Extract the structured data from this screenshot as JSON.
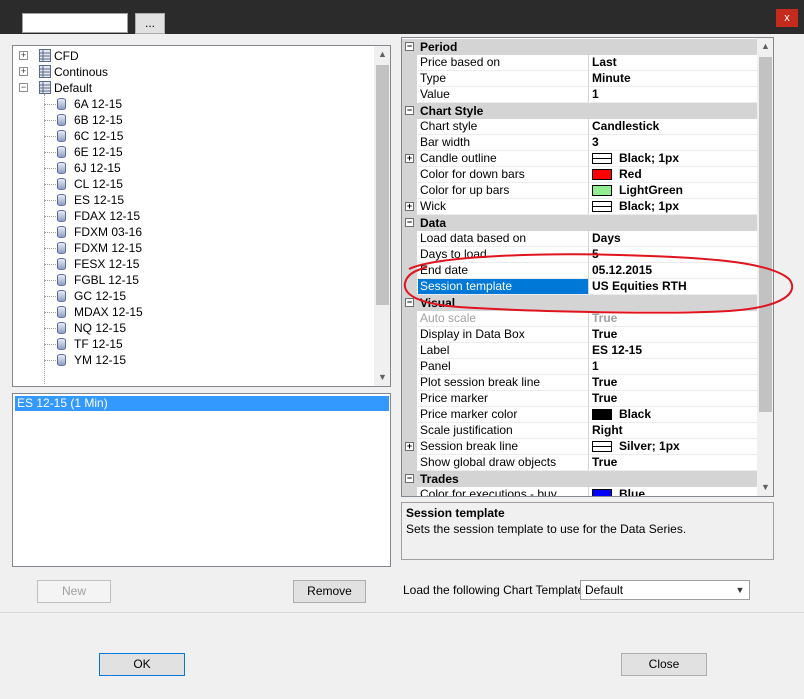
{
  "window": {
    "close_glyph": "x"
  },
  "search": {
    "value": "",
    "placeholder": ""
  },
  "browse_button": {
    "label": "..."
  },
  "tree": {
    "nodes": [
      {
        "label": "CFD",
        "level": 0,
        "expander": "+"
      },
      {
        "label": "Continous",
        "level": 0,
        "expander": "+"
      },
      {
        "label": "Default",
        "level": 0,
        "expander": "−"
      },
      {
        "label": "6A 12-15",
        "level": 1
      },
      {
        "label": "6B 12-15",
        "level": 1
      },
      {
        "label": "6C 12-15",
        "level": 1
      },
      {
        "label": "6E 12-15",
        "level": 1
      },
      {
        "label": "6J 12-15",
        "level": 1
      },
      {
        "label": "CL 12-15",
        "level": 1
      },
      {
        "label": "ES 12-15",
        "level": 1
      },
      {
        "label": "FDAX 12-15",
        "level": 1
      },
      {
        "label": "FDXM 03-16",
        "level": 1
      },
      {
        "label": "FDXM 12-15",
        "level": 1
      },
      {
        "label": "FESX 12-15",
        "level": 1
      },
      {
        "label": "FGBL 12-15",
        "level": 1
      },
      {
        "label": "GC 12-15",
        "level": 1
      },
      {
        "label": "MDAX 12-15",
        "level": 1
      },
      {
        "label": "NQ 12-15",
        "level": 1
      },
      {
        "label": "TF 12-15",
        "level": 1
      },
      {
        "label": "YM 12-15",
        "level": 1
      }
    ],
    "scroll_up_glyph": "▲",
    "scroll_down_glyph": "▼"
  },
  "series_list": {
    "items": [
      "ES 12-15 (1 Min)"
    ]
  },
  "buttons": {
    "new": "New",
    "remove": "Remove",
    "ok": "OK",
    "close": "Close"
  },
  "properties": {
    "rows": [
      {
        "kind": "category",
        "label": "Period",
        "toggle": "−"
      },
      {
        "kind": "prop",
        "name": "Price based on",
        "value": "Last"
      },
      {
        "kind": "prop",
        "name": "Type",
        "value": "Minute"
      },
      {
        "kind": "prop",
        "name": "Value",
        "value": "1"
      },
      {
        "kind": "category",
        "label": "Chart Style",
        "toggle": "−"
      },
      {
        "kind": "prop",
        "name": "Chart style",
        "value": "Candlestick"
      },
      {
        "kind": "prop",
        "name": "Bar width",
        "value": "3"
      },
      {
        "kind": "prop",
        "name": "Candle outline",
        "value": "Black; 1px",
        "swatch": "line",
        "expandable": "+"
      },
      {
        "kind": "prop",
        "name": "Color for down bars",
        "value": "Red",
        "swatch": "#ff0000"
      },
      {
        "kind": "prop",
        "name": "Color for up bars",
        "value": "LightGreen",
        "swatch": "#90ee90"
      },
      {
        "kind": "prop",
        "name": "Wick",
        "value": "Black; 1px",
        "swatch": "line",
        "expandable": "+"
      },
      {
        "kind": "category",
        "label": "Data",
        "toggle": "−"
      },
      {
        "kind": "prop",
        "name": "Load data based on",
        "value": "Days"
      },
      {
        "kind": "prop",
        "name": "Days to load",
        "value": "5"
      },
      {
        "kind": "prop",
        "name": "End date",
        "value": "05.12.2015"
      },
      {
        "kind": "prop",
        "name": "Session template",
        "value": "US Equities RTH",
        "selected": true,
        "dropdown": "▼"
      },
      {
        "kind": "category",
        "label": "Visual",
        "toggle": "−"
      },
      {
        "kind": "prop",
        "name": "Auto scale",
        "value": "True",
        "greyed": true
      },
      {
        "kind": "prop",
        "name": "Display in Data Box",
        "value": "True"
      },
      {
        "kind": "prop",
        "name": "Label",
        "value": "ES 12-15"
      },
      {
        "kind": "prop",
        "name": "Panel",
        "value": "1"
      },
      {
        "kind": "prop",
        "name": "Plot session break line",
        "value": "True"
      },
      {
        "kind": "prop",
        "name": "Price marker",
        "value": "True"
      },
      {
        "kind": "prop",
        "name": "Price marker color",
        "value": "Black",
        "swatch": "#000000"
      },
      {
        "kind": "prop",
        "name": "Scale justification",
        "value": "Right"
      },
      {
        "kind": "prop",
        "name": "Session break line",
        "value": "Silver; 1px",
        "swatch": "line",
        "expandable": "+"
      },
      {
        "kind": "prop",
        "name": "Show global draw objects",
        "value": "True"
      },
      {
        "kind": "category",
        "label": "Trades",
        "toggle": "−"
      },
      {
        "kind": "prop",
        "name": "Color for executions - buy",
        "value": "Blue",
        "swatch": "#0000ff"
      }
    ]
  },
  "description": {
    "title": "Session template",
    "text": "Sets the session template to use for the Data Series."
  },
  "template": {
    "label": "Load the following Chart Template:",
    "selected": "Default",
    "arrow": "▼"
  },
  "colors": {
    "selection": "#3399ff",
    "property_selected": "#0078d7",
    "annotation": "#e0141e",
    "close_button": "#c42b1c"
  }
}
